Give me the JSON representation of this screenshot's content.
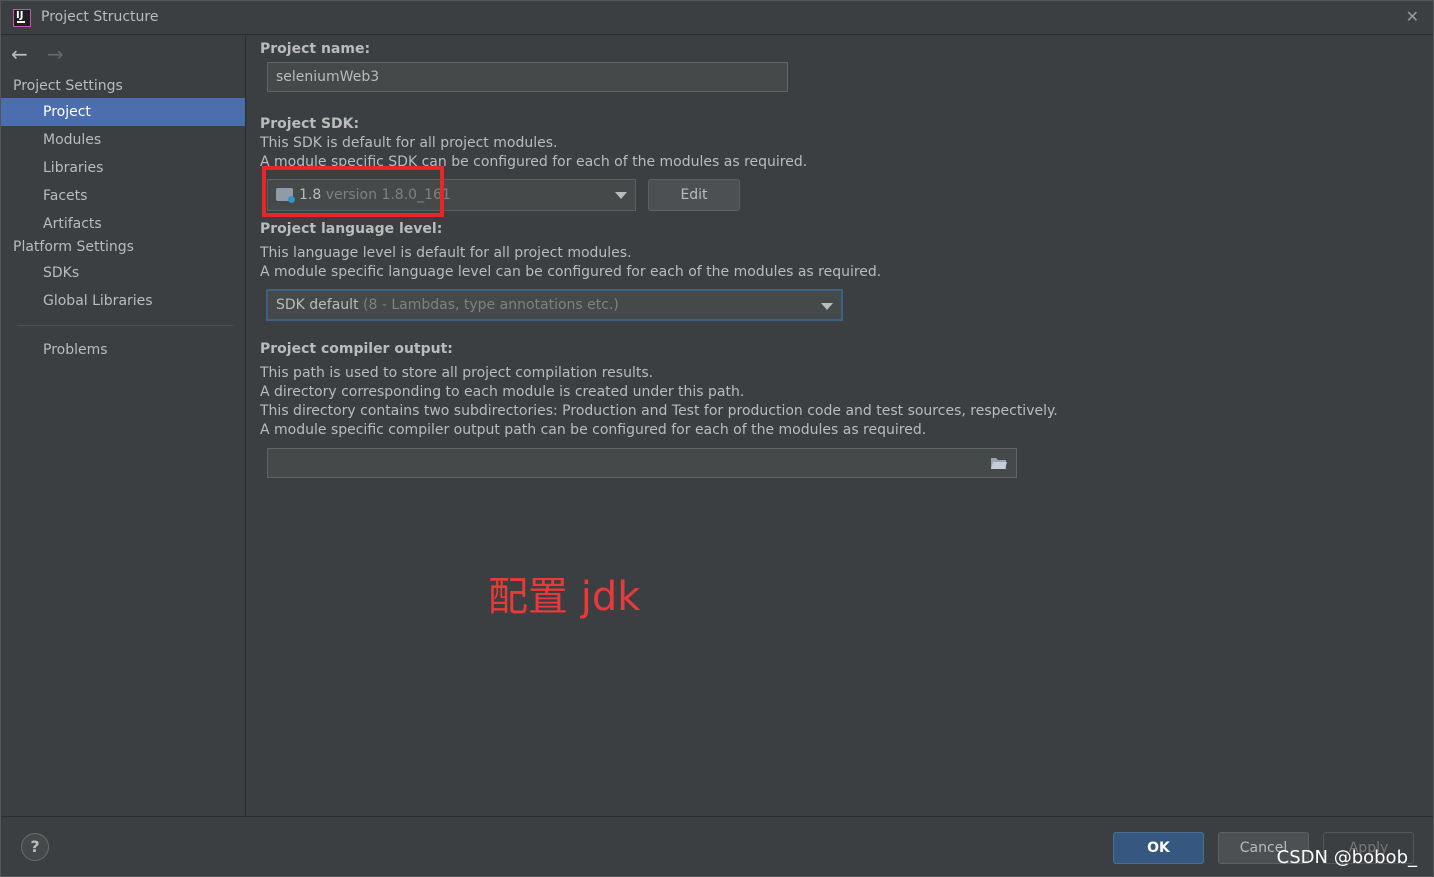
{
  "window": {
    "title": "Project Structure",
    "close_glyph": "✕"
  },
  "sidebar": {
    "back_glyph": "←",
    "forward_glyph": "→",
    "project_settings_label": "Project Settings",
    "project_settings_items": [
      {
        "label": "Project",
        "selected": true
      },
      {
        "label": "Modules"
      },
      {
        "label": "Libraries"
      },
      {
        "label": "Facets"
      },
      {
        "label": "Artifacts"
      }
    ],
    "platform_settings_label": "Platform Settings",
    "platform_settings_items": [
      {
        "label": "SDKs"
      },
      {
        "label": "Global Libraries"
      }
    ],
    "problems_label": "Problems"
  },
  "main": {
    "project_name_label": "Project name:",
    "project_name_value": "seleniumWeb3",
    "sdk_label": "Project SDK:",
    "sdk_desc_1": "This SDK is default for all project modules.",
    "sdk_desc_2": "A module specific SDK can be configured for each of the modules as required.",
    "sdk_value_main": "1.8",
    "sdk_value_dim": "version 1.8.0_161",
    "edit_label": "Edit",
    "lang_label": "Project language level:",
    "lang_desc_1": "This language level is default for all project modules.",
    "lang_desc_2": "A module specific language level can be configured for each of the modules as required.",
    "lang_value_main": "SDK default",
    "lang_value_dim": "(8 - Lambdas, type annotations etc.)",
    "output_label": "Project compiler output:",
    "output_desc_1": "This path is used to store all project compilation results.",
    "output_desc_2": "A directory corresponding to each module is created under this path.",
    "output_desc_3": "This directory contains two subdirectories: Production and Test for production code and test sources, respectively.",
    "output_desc_4": "A module specific compiler output path can be configured for each of the modules as required.",
    "output_value": ""
  },
  "annotation": {
    "text": "配置 jdk",
    "color": "#e83a3a"
  },
  "footer": {
    "help_glyph": "?",
    "ok_label": "OK",
    "cancel_label": "Cancel",
    "apply_label": "Apply"
  },
  "watermark": "CSDN @bobob_",
  "colors": {
    "background": "#3c3f41",
    "selection": "#4b6eaf",
    "primary_button": "#365880",
    "annotation_red": "#e8262a"
  }
}
